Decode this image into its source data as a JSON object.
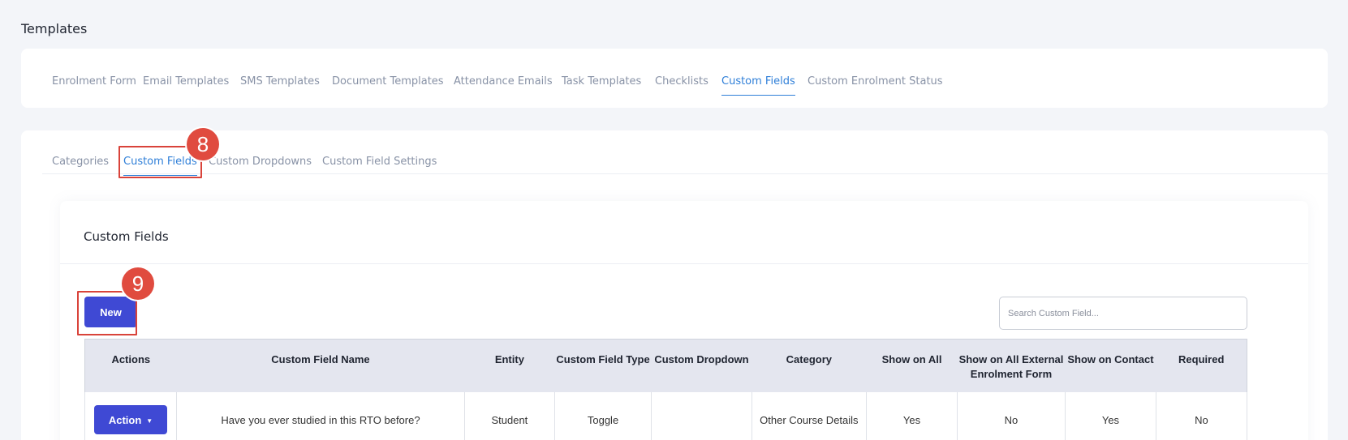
{
  "page": {
    "title": "Templates"
  },
  "top_tabs": [
    {
      "label": "Enrolment Form",
      "active": false
    },
    {
      "label": "Email Templates",
      "active": false
    },
    {
      "label": "SMS Templates",
      "active": false
    },
    {
      "label": "Document Templates",
      "active": false
    },
    {
      "label": "Attendance Emails",
      "active": false
    },
    {
      "label": "Task Templates",
      "active": false
    },
    {
      "label": "Checklists",
      "active": false
    },
    {
      "label": "Custom Fields",
      "active": true
    },
    {
      "label": "Custom Enrolment Status",
      "active": false
    }
  ],
  "sub_tabs": [
    {
      "label": "Categories",
      "active": false
    },
    {
      "label": "Custom Fields",
      "active": true
    },
    {
      "label": "Custom Dropdowns",
      "active": false
    },
    {
      "label": "Custom Field Settings",
      "active": false
    }
  ],
  "annotations": {
    "step_8": "8",
    "step_9": "9"
  },
  "panel": {
    "title": "Custom Fields",
    "new_label": "New",
    "search_placeholder": "Search Custom Field..."
  },
  "table": {
    "columns": [
      "Actions",
      "Custom Field Name",
      "Entity",
      "Custom Field Type",
      "Custom Dropdown",
      "Category",
      "Show on All",
      "Show on All External Enrolment Form",
      "Show on Contact",
      "Required"
    ],
    "rows": [
      {
        "action_label": "Action",
        "name": "Have you ever studied in this RTO before?",
        "entity": "Student",
        "type": "Toggle",
        "dropdown": "",
        "category": "Other Course Details",
        "show_all": "Yes",
        "show_external": "No",
        "show_contact": "Yes",
        "required": "No"
      }
    ]
  },
  "colors": {
    "accent": "#2f7fd8",
    "button": "#3f49d4",
    "annotation": "#e04b3f"
  }
}
